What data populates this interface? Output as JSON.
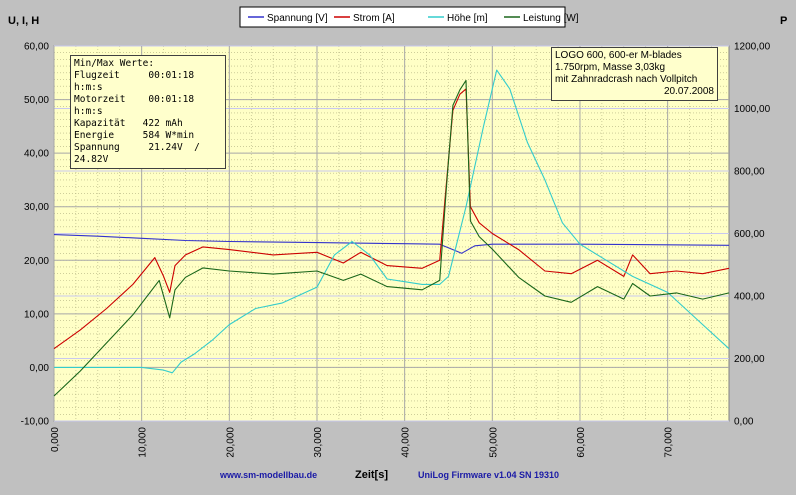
{
  "chart_data": {
    "type": "line",
    "title": "",
    "xlabel": "Zeit[s]",
    "ylabel_left": "U, I, H",
    "ylabel_right": "P",
    "xlim": [
      0,
      77000
    ],
    "ylim_left": [
      -10,
      60
    ],
    "ylim_right": [
      0,
      1200
    ],
    "x_ticks": [
      "0,000",
      "10,000",
      "20,000",
      "30,000",
      "40,000",
      "50,000",
      "60,000",
      "70,000"
    ],
    "y_ticks_left": [
      "-10,00",
      "0,00",
      "10,00",
      "20,00",
      "30,00",
      "40,00",
      "50,00",
      "60,00"
    ],
    "y_ticks_right": [
      "0,00",
      "200,00",
      "400,00",
      "600,00",
      "800,00",
      "1000,00",
      "1200,00"
    ],
    "grid": true,
    "legend_position": "top",
    "series": [
      {
        "name": "Spannung [V]",
        "axis": "left",
        "color": "#3333cc",
        "x": [
          0,
          5000,
          10000,
          15000,
          20000,
          30000,
          40000,
          44000,
          45500,
          46500,
          48000,
          50000,
          60000,
          70000,
          77000
        ],
        "y": [
          24.8,
          24.5,
          24.1,
          23.7,
          23.5,
          23.3,
          23.1,
          23.0,
          22.0,
          21.3,
          22.7,
          23.0,
          23.0,
          22.9,
          22.8
        ]
      },
      {
        "name": "Strom [A]",
        "axis": "left",
        "color": "#cc0000",
        "x": [
          0,
          3000,
          6000,
          9000,
          11500,
          12500,
          13200,
          13800,
          15000,
          17000,
          20000,
          25000,
          30000,
          33000,
          35000,
          38000,
          42000,
          44000,
          44800,
          45500,
          46300,
          47000,
          47500,
          48500,
          50000,
          53000,
          56000,
          59000,
          62000,
          65000,
          66000,
          68000,
          71000,
          74000,
          77000
        ],
        "y": [
          3.5,
          7,
          11,
          15.5,
          20.5,
          17,
          14,
          19,
          21,
          22.5,
          22,
          21,
          21.5,
          19.5,
          21.5,
          19,
          18.5,
          20,
          35,
          48,
          51,
          52,
          30,
          27,
          25,
          22,
          18,
          17.5,
          20,
          17,
          21,
          17.5,
          18,
          17.5,
          18.5
        ]
      },
      {
        "name": "Höhe [m]",
        "axis": "left",
        "color": "#33cccc",
        "x": [
          0,
          5000,
          10000,
          12500,
          13500,
          14500,
          16000,
          18000,
          20000,
          23000,
          26000,
          30000,
          32000,
          34000,
          36000,
          38000,
          40000,
          42000,
          44000,
          45000,
          47000,
          49000,
          50500,
          52000,
          54000,
          56000,
          58000,
          60000,
          63000,
          66000,
          70000,
          74000,
          77000
        ],
        "y": [
          0,
          0,
          0,
          -0.5,
          -1,
          1,
          2.5,
          5,
          8,
          11,
          12,
          15,
          21,
          23.5,
          21,
          16.5,
          16,
          15.5,
          15.5,
          17,
          30,
          45,
          55.5,
          52,
          42,
          35,
          27,
          23,
          20,
          17,
          14,
          8,
          3.5
        ]
      },
      {
        "name": "Leistung [W]",
        "axis": "right",
        "color": "#1a661a",
        "x": [
          0,
          3000,
          6000,
          9000,
          12000,
          13200,
          13800,
          15000,
          17000,
          20000,
          25000,
          30000,
          33000,
          35000,
          38000,
          42000,
          44000,
          44800,
          45500,
          46300,
          47000,
          47500,
          48500,
          50000,
          53000,
          56000,
          59000,
          62000,
          65000,
          66000,
          68000,
          71000,
          74000,
          77000
        ],
        "y": [
          80,
          160,
          250,
          340,
          450,
          330,
          420,
          460,
          490,
          480,
          470,
          480,
          450,
          470,
          430,
          420,
          450,
          760,
          1010,
          1060,
          1090,
          640,
          590,
          550,
          460,
          400,
          380,
          430,
          390,
          440,
          400,
          410,
          390,
          410
        ]
      }
    ],
    "annotations": {
      "stats_box": [
        "Min/Max Werte:",
        "Flugzeit     00:01:18",
        "h:m:s",
        "Motorzeit    00:01:18",
        "h:m:s",
        "Kapazität   422 mAh",
        "Energie     584 W*min",
        "Spannung     21.24V  /",
        "24.82V"
      ],
      "note_box": [
        "LOGO 600, 600-er M-blades",
        "1.750rpm, Masse 3,03kg",
        "mit Zahnradcrash nach Vollpitch",
        "20.07.2008"
      ],
      "footer_left": "www.sm-modellbau.de",
      "footer_right": "UniLog Firmware v1.04 SN 19310"
    }
  }
}
